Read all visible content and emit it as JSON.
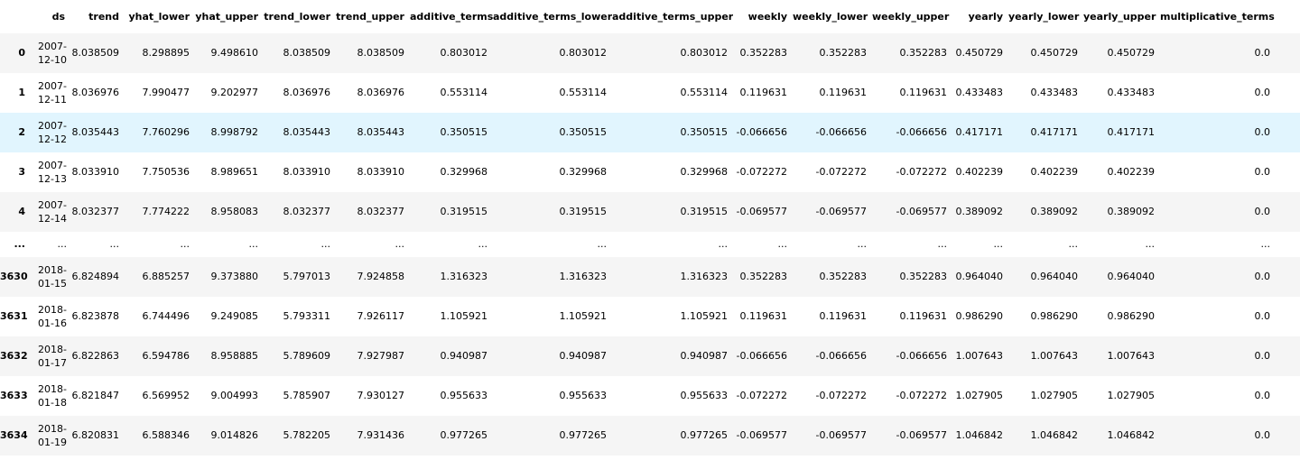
{
  "columns": [
    "ds",
    "trend",
    "yhat_lower",
    "yhat_upper",
    "trend_lower",
    "trend_upper",
    "additive_terms",
    "additive_terms_lower",
    "additive_terms_upper",
    "weekly",
    "weekly_lower",
    "weekly_upper",
    "yearly",
    "yearly_lower",
    "yearly_upper",
    "multiplicative_terms",
    "mult"
  ],
  "rows": [
    {
      "index": "0",
      "ds1": "2007-",
      "ds2": "12-10",
      "cells": [
        "8.038509",
        "8.298895",
        "9.498610",
        "8.038509",
        "8.038509",
        "0.803012",
        "0.803012",
        "0.803012",
        "0.352283",
        "0.352283",
        "0.352283",
        "0.450729",
        "0.450729",
        "0.450729",
        "0.0"
      ]
    },
    {
      "index": "1",
      "ds1": "2007-",
      "ds2": "12-11",
      "cells": [
        "8.036976",
        "7.990477",
        "9.202977",
        "8.036976",
        "8.036976",
        "0.553114",
        "0.553114",
        "0.553114",
        "0.119631",
        "0.119631",
        "0.119631",
        "0.433483",
        "0.433483",
        "0.433483",
        "0.0"
      ]
    },
    {
      "index": "2",
      "ds1": "2007-",
      "ds2": "12-12",
      "cells": [
        "8.035443",
        "7.760296",
        "8.998792",
        "8.035443",
        "8.035443",
        "0.350515",
        "0.350515",
        "0.350515",
        "-0.066656",
        "-0.066656",
        "-0.066656",
        "0.417171",
        "0.417171",
        "0.417171",
        "0.0"
      ]
    },
    {
      "index": "3",
      "ds1": "2007-",
      "ds2": "12-13",
      "cells": [
        "8.033910",
        "7.750536",
        "8.989651",
        "8.033910",
        "8.033910",
        "0.329968",
        "0.329968",
        "0.329968",
        "-0.072272",
        "-0.072272",
        "-0.072272",
        "0.402239",
        "0.402239",
        "0.402239",
        "0.0"
      ]
    },
    {
      "index": "4",
      "ds1": "2007-",
      "ds2": "12-14",
      "cells": [
        "8.032377",
        "7.774222",
        "8.958083",
        "8.032377",
        "8.032377",
        "0.319515",
        "0.319515",
        "0.319515",
        "-0.069577",
        "-0.069577",
        "-0.069577",
        "0.389092",
        "0.389092",
        "0.389092",
        "0.0"
      ]
    },
    {
      "index": "...",
      "ds1": "...",
      "ds2": "",
      "cells": [
        "...",
        "...",
        "...",
        "...",
        "...",
        "...",
        "...",
        "...",
        "...",
        "...",
        "...",
        "...",
        "...",
        "...",
        "..."
      ]
    },
    {
      "index": "3630",
      "ds1": "2018-",
      "ds2": "01-15",
      "cells": [
        "6.824894",
        "6.885257",
        "9.373880",
        "5.797013",
        "7.924858",
        "1.316323",
        "1.316323",
        "1.316323",
        "0.352283",
        "0.352283",
        "0.352283",
        "0.964040",
        "0.964040",
        "0.964040",
        "0.0"
      ]
    },
    {
      "index": "3631",
      "ds1": "2018-",
      "ds2": "01-16",
      "cells": [
        "6.823878",
        "6.744496",
        "9.249085",
        "5.793311",
        "7.926117",
        "1.105921",
        "1.105921",
        "1.105921",
        "0.119631",
        "0.119631",
        "0.119631",
        "0.986290",
        "0.986290",
        "0.986290",
        "0.0"
      ]
    },
    {
      "index": "3632",
      "ds1": "2018-",
      "ds2": "01-17",
      "cells": [
        "6.822863",
        "6.594786",
        "8.958885",
        "5.789609",
        "7.927987",
        "0.940987",
        "0.940987",
        "0.940987",
        "-0.066656",
        "-0.066656",
        "-0.066656",
        "1.007643",
        "1.007643",
        "1.007643",
        "0.0"
      ]
    },
    {
      "index": "3633",
      "ds1": "2018-",
      "ds2": "01-18",
      "cells": [
        "6.821847",
        "6.569952",
        "9.004993",
        "5.785907",
        "7.930127",
        "0.955633",
        "0.955633",
        "0.955633",
        "-0.072272",
        "-0.072272",
        "-0.072272",
        "1.027905",
        "1.027905",
        "1.027905",
        "0.0"
      ]
    },
    {
      "index": "3634",
      "ds1": "2018-",
      "ds2": "01-19",
      "cells": [
        "6.820831",
        "6.588346",
        "9.014826",
        "5.782205",
        "7.931436",
        "0.977265",
        "0.977265",
        "0.977265",
        "-0.069577",
        "-0.069577",
        "-0.069577",
        "1.046842",
        "1.046842",
        "1.046842",
        "0.0"
      ]
    }
  ],
  "colors": {
    "odd_row": "#f5f5f5",
    "even_row": "#ffffff",
    "hover_row": "#e1f5fe"
  }
}
